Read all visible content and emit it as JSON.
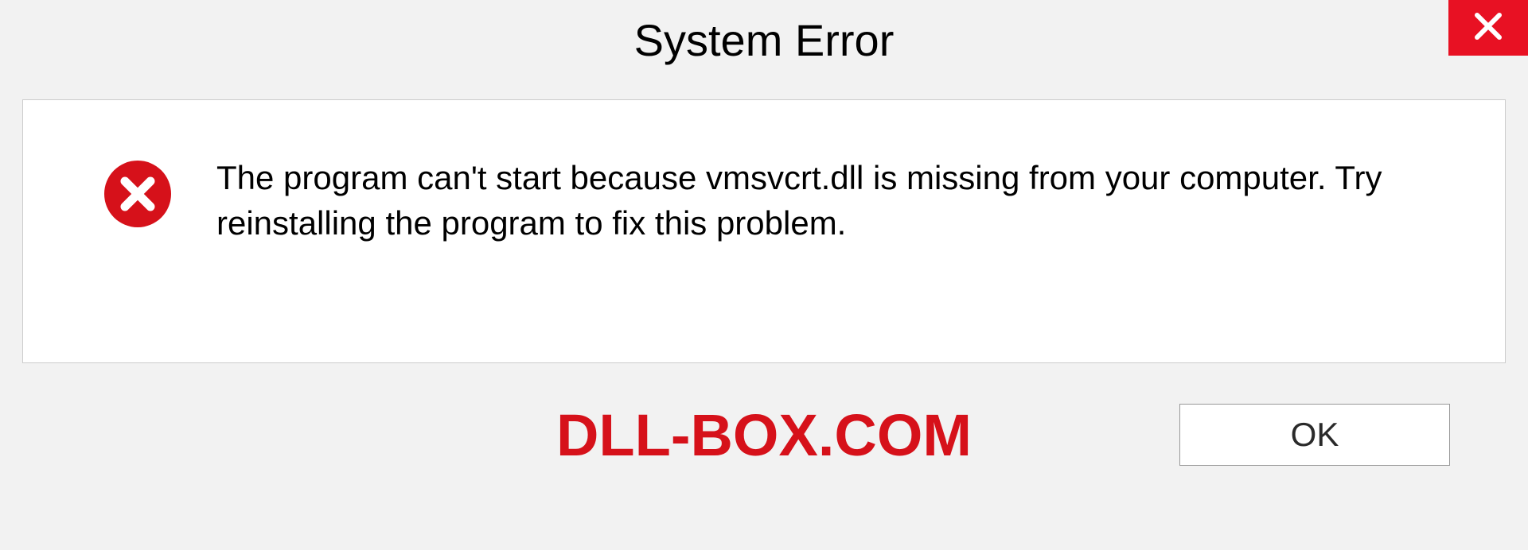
{
  "dialog": {
    "title": "System Error",
    "message": "The program can't start because vmsvcrt.dll is missing from your computer. Try reinstalling the program to fix this problem.",
    "ok_label": "OK"
  },
  "watermark": {
    "text": "DLL-BOX.COM"
  },
  "colors": {
    "close_bg": "#e81123",
    "error_icon": "#d6111a",
    "watermark": "#d6111a"
  }
}
